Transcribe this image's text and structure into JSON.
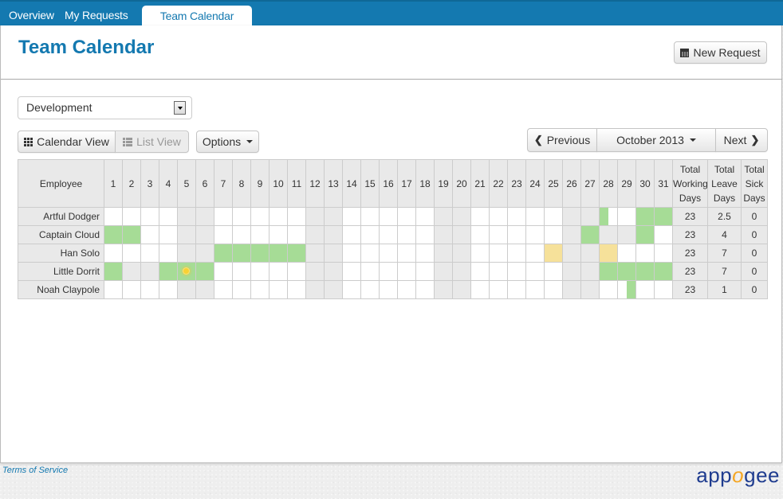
{
  "nav": {
    "tabs": [
      {
        "label": "Overview",
        "active": false
      },
      {
        "label": "My Requests",
        "active": false
      },
      {
        "label": "Team Calendar",
        "active": true
      }
    ]
  },
  "header": {
    "title": "Team Calendar",
    "new_request_label": "New Request"
  },
  "filters": {
    "department_selected": "Development",
    "calendar_view_label": "Calendar View",
    "list_view_label": "List View",
    "options_label": "Options"
  },
  "month_nav": {
    "previous_label": "Previous",
    "current_label": "October 2013",
    "next_label": "Next"
  },
  "calendar": {
    "employee_header": "Employee",
    "days": [
      1,
      2,
      3,
      4,
      5,
      6,
      7,
      8,
      9,
      10,
      11,
      12,
      13,
      14,
      15,
      16,
      17,
      18,
      19,
      20,
      21,
      22,
      23,
      24,
      25,
      26,
      27,
      28,
      29,
      30,
      31
    ],
    "weekend_days": [
      5,
      6,
      12,
      13,
      19,
      20,
      26,
      27
    ],
    "totals_headers": [
      "Total Working Days",
      "Total Leave Days",
      "Total Sick Days"
    ],
    "legend_colors": {
      "leave": "#a6dc96",
      "sick": "#f6e19a",
      "non_working": "#e9e9e9"
    },
    "rows": [
      {
        "employee": "Artful Dodger",
        "cells": {
          "28": "leave-am",
          "30": "leave",
          "31": "leave"
        },
        "working_days": "23",
        "leave_days": "2.5",
        "sick_days": "0"
      },
      {
        "employee": "Captain Cloud",
        "cells": {
          "1": "leave",
          "2": "leave",
          "27": "leave",
          "28": "off",
          "29": "off",
          "30": "leave"
        },
        "working_days": "23",
        "leave_days": "4",
        "sick_days": "0"
      },
      {
        "employee": "Han Solo",
        "cells": {
          "7": "leave",
          "8": "leave",
          "9": "leave",
          "10": "leave",
          "11": "leave",
          "25": "sick",
          "28": "sick"
        },
        "working_days": "23",
        "leave_days": "7",
        "sick_days": "0"
      },
      {
        "employee": "Little Dorrit",
        "cells": {
          "1": "leave",
          "2": "off",
          "3": "off",
          "4": "leave",
          "5": "leave-holiday",
          "6": "leave",
          "28": "leave",
          "29": "leave",
          "30": "leave",
          "31": "leave"
        },
        "working_days": "23",
        "leave_days": "7",
        "sick_days": "0"
      },
      {
        "employee": "Noah Claypole",
        "cells": {
          "29": "leave-pm"
        },
        "working_days": "23",
        "leave_days": "1",
        "sick_days": "0"
      }
    ]
  },
  "footer": {
    "terms_label": "Terms of Service",
    "logo_text_a": "app",
    "logo_text_o": "o",
    "logo_text_b": "gee"
  }
}
